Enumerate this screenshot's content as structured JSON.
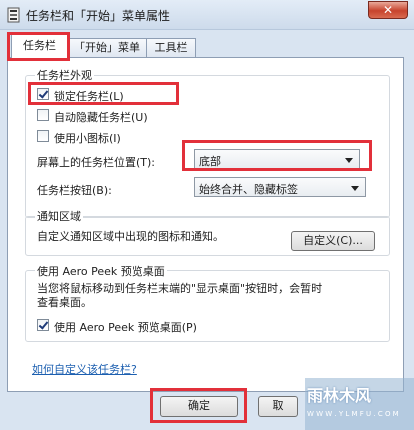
{
  "window": {
    "title": "任务栏和「开始」菜单属性",
    "close_symbol": "✕"
  },
  "tabs": [
    {
      "label": "任务栏",
      "active": true
    },
    {
      "label": "「开始」菜单",
      "active": false
    },
    {
      "label": "工具栏",
      "active": false
    }
  ],
  "appearance": {
    "title": "任务栏外观",
    "checkboxes": [
      {
        "label": "锁定任务栏(L)",
        "checked": true
      },
      {
        "label": "自动隐藏任务栏(U)",
        "checked": false
      },
      {
        "label": "使用小图标(I)",
        "checked": false
      }
    ],
    "position_label": "屏幕上的任务栏位置(T):",
    "position_value": "底部",
    "buttons_label": "任务栏按钮(B):",
    "buttons_value": "始终合并、隐藏标签"
  },
  "notification": {
    "title": "通知区域",
    "description": "自定义通知区域中出现的图标和通知。",
    "customize_label": "自定义(C)..."
  },
  "aero_peek": {
    "title": "使用 Aero Peek 预览桌面",
    "description_line1": "当您将鼠标移动到任务栏末端的\"显示桌面\"按钮时，会暂时",
    "description_line2": "查看桌面。",
    "checkbox_label": "使用 Aero Peek 预览桌面(P)",
    "checked": true
  },
  "help_link": "如何自定义该任务栏?",
  "footer": {
    "ok_label": "确定",
    "cancel_label": "取"
  },
  "watermark": {
    "brand": "雨林木风",
    "url": "W W W . Y L M F U . C O M"
  },
  "colors": {
    "highlight": "#e2303a",
    "link": "#1c5fb0",
    "close": "#c7432d"
  }
}
